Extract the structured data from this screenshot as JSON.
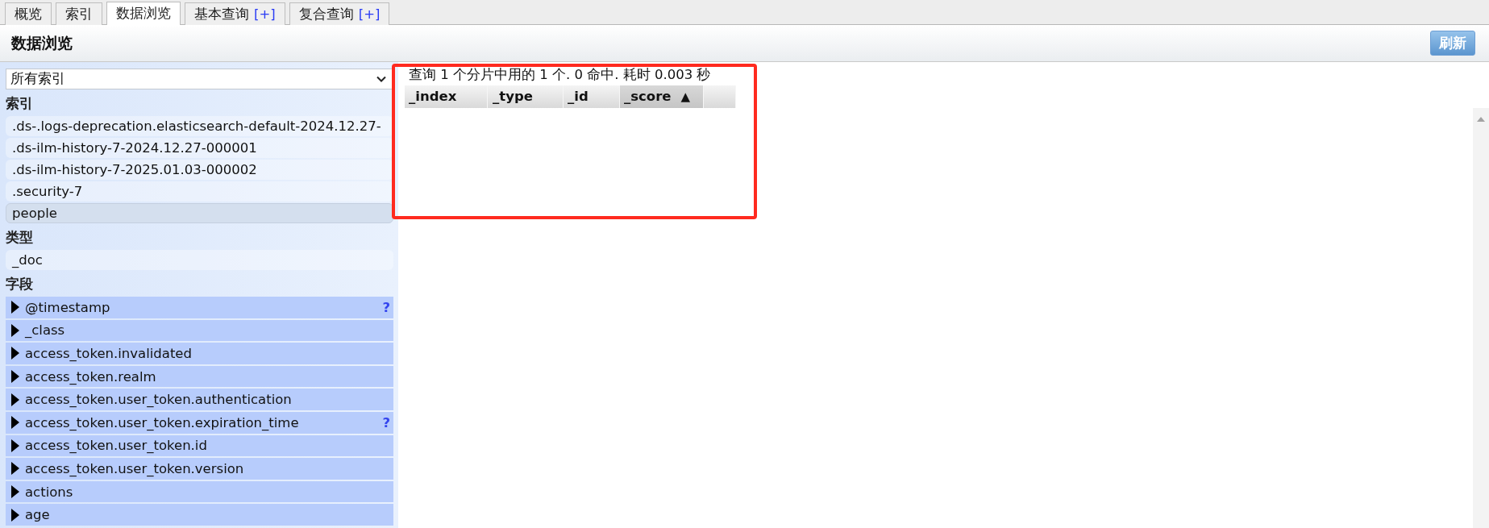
{
  "tabs": [
    {
      "label": "概览",
      "selected": false
    },
    {
      "label": "索引",
      "selected": false
    },
    {
      "label": "数据浏览",
      "selected": true
    },
    {
      "label": "基本查询",
      "selected": false,
      "add_link": "[+]"
    },
    {
      "label": "复合查询",
      "selected": false,
      "add_link": "[+]"
    }
  ],
  "header": {
    "title": "数据浏览",
    "refresh_button": "刷新"
  },
  "sidebar": {
    "index_select": {
      "value": "所有索引"
    },
    "sections": [
      {
        "title": "索引",
        "kind": "list",
        "items": [
          {
            "label": ".ds-.logs-deprecation.elasticsearch-default-2024.12.27-",
            "selected": false
          },
          {
            "label": ".ds-ilm-history-7-2024.12.27-000001",
            "selected": false
          },
          {
            "label": ".ds-ilm-history-7-2025.01.03-000002",
            "selected": false
          },
          {
            "label": ".security-7",
            "selected": false
          },
          {
            "label": "people",
            "selected": true
          }
        ]
      },
      {
        "title": "类型",
        "kind": "list",
        "items": [
          {
            "label": "_doc",
            "selected": false
          }
        ]
      },
      {
        "title": "字段",
        "kind": "fields",
        "items": [
          {
            "label": "@timestamp",
            "expanded": false,
            "help": "?"
          },
          {
            "label": "_class",
            "expanded": false
          },
          {
            "label": "access_token.invalidated",
            "expanded": false
          },
          {
            "label": "access_token.realm",
            "expanded": false
          },
          {
            "label": "access_token.user_token.authentication",
            "expanded": false
          },
          {
            "label": "access_token.user_token.expiration_time",
            "expanded": false,
            "help": "?"
          },
          {
            "label": "access_token.user_token.id",
            "expanded": false
          },
          {
            "label": "access_token.user_token.version",
            "expanded": false
          },
          {
            "label": "actions",
            "expanded": false
          },
          {
            "label": "age",
            "expanded": false
          }
        ]
      }
    ]
  },
  "results": {
    "highlighted": true,
    "summary": "查询 1 个分片中用的 1 个. 0 命中. 耗时 0.003 秒",
    "table": {
      "columns": [
        {
          "label": "_index",
          "sorted": false
        },
        {
          "label": "_type",
          "sorted": false
        },
        {
          "label": "_id",
          "sorted": false
        },
        {
          "label": "_score",
          "sorted": true,
          "sort_mark": "▲"
        }
      ]
    }
  }
}
